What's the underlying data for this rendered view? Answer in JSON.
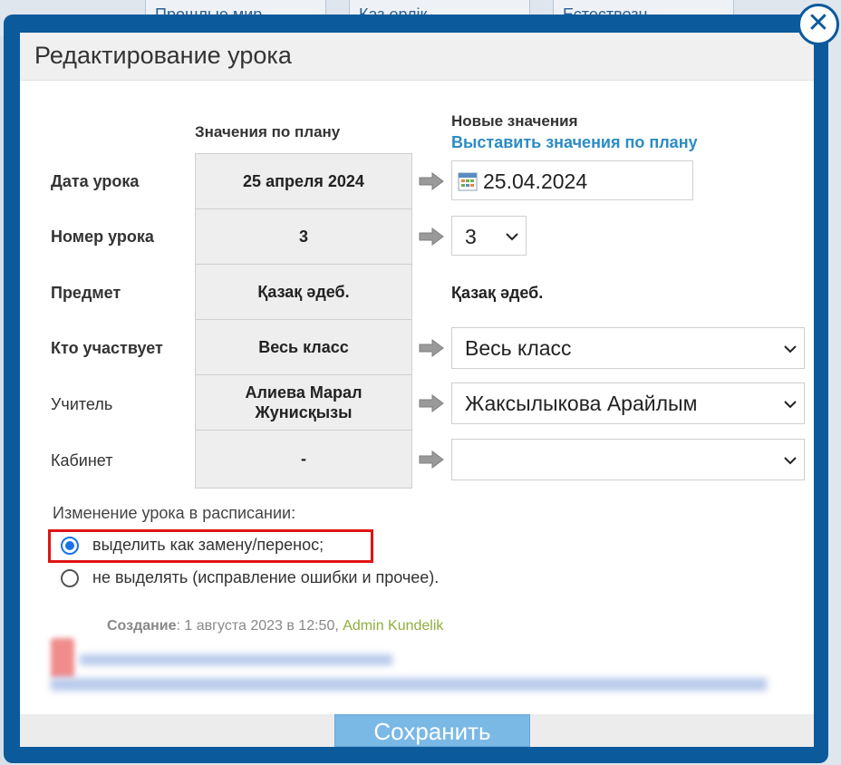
{
  "background": {
    "tabs": [
      "Прошлые мир",
      "Каз ерлік",
      "Естествозн"
    ]
  },
  "modal": {
    "title": "Редактирование урока",
    "close_glyph": "✕"
  },
  "headers": {
    "plan": "Значения по плану",
    "new": "Новые значения",
    "reset_link": "Выставить значения по плану"
  },
  "rows": [
    {
      "label": "Дата урока",
      "plan": "25 апреля 2024",
      "value": "25.04.2024"
    },
    {
      "label": "Номер урока",
      "plan": "3",
      "value": "3"
    },
    {
      "label": "Предмет",
      "plan": "Қазақ әдеб.",
      "value": "Қазақ әдеб."
    },
    {
      "label": "Кто участвует",
      "plan": "Весь класс",
      "value": "Весь класс"
    },
    {
      "label": "Учитель",
      "plan_line1": "Алиева Марал",
      "plan_line2": "Жунисқызы",
      "value": "Жаксылыкова Арайлым"
    },
    {
      "label": "Кабинет",
      "plan": "-",
      "value": ""
    }
  ],
  "schedule_change": {
    "title": "Изменение урока в расписании:",
    "options": [
      {
        "label": "выделить как замену/перенос;",
        "selected": true
      },
      {
        "label": "не выделять (исправление ошибки и прочее).",
        "selected": false
      }
    ]
  },
  "meta": {
    "created_label": "Создание",
    "created_date": "1 августа 2023 в 12:50,",
    "author": "Admin Kundelik"
  },
  "footer": {
    "save_label": "Сохранить"
  },
  "colors": {
    "modal_border": "#0b5a9c",
    "link": "#2b8cc4",
    "save_button": "#7ab8e6",
    "highlight": "#e01414",
    "radio_selected": "#1a73e8"
  }
}
